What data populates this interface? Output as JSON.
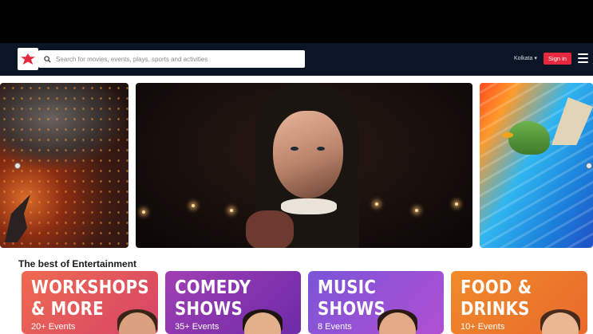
{
  "header": {
    "search_placeholder": "Search for movies, events, plays, sports and activities",
    "city": "Kolkata",
    "city_caret": "▾",
    "signin_label": "Sign in"
  },
  "section": {
    "title": "The best of Entertainment"
  },
  "cards": [
    {
      "title_line1": "WORKSHOPS",
      "title_line2": "& MORE",
      "count": "20+ Events",
      "color": "#e85a58"
    },
    {
      "title_line1": "COMEDY",
      "title_line2": "SHOWS",
      "count": "35+ Events",
      "color": "#8f36ae"
    },
    {
      "title_line1": "MUSIC",
      "title_line2": "SHOWS",
      "count": "8 Events",
      "color": "#9552d6"
    },
    {
      "title_line1": "FOOD &",
      "title_line2": "DRINKS",
      "count": "10+ Events",
      "color": "#ee7d2b"
    }
  ],
  "colors": {
    "header_bg": "#0c1526",
    "accent_red": "#e5283e"
  }
}
